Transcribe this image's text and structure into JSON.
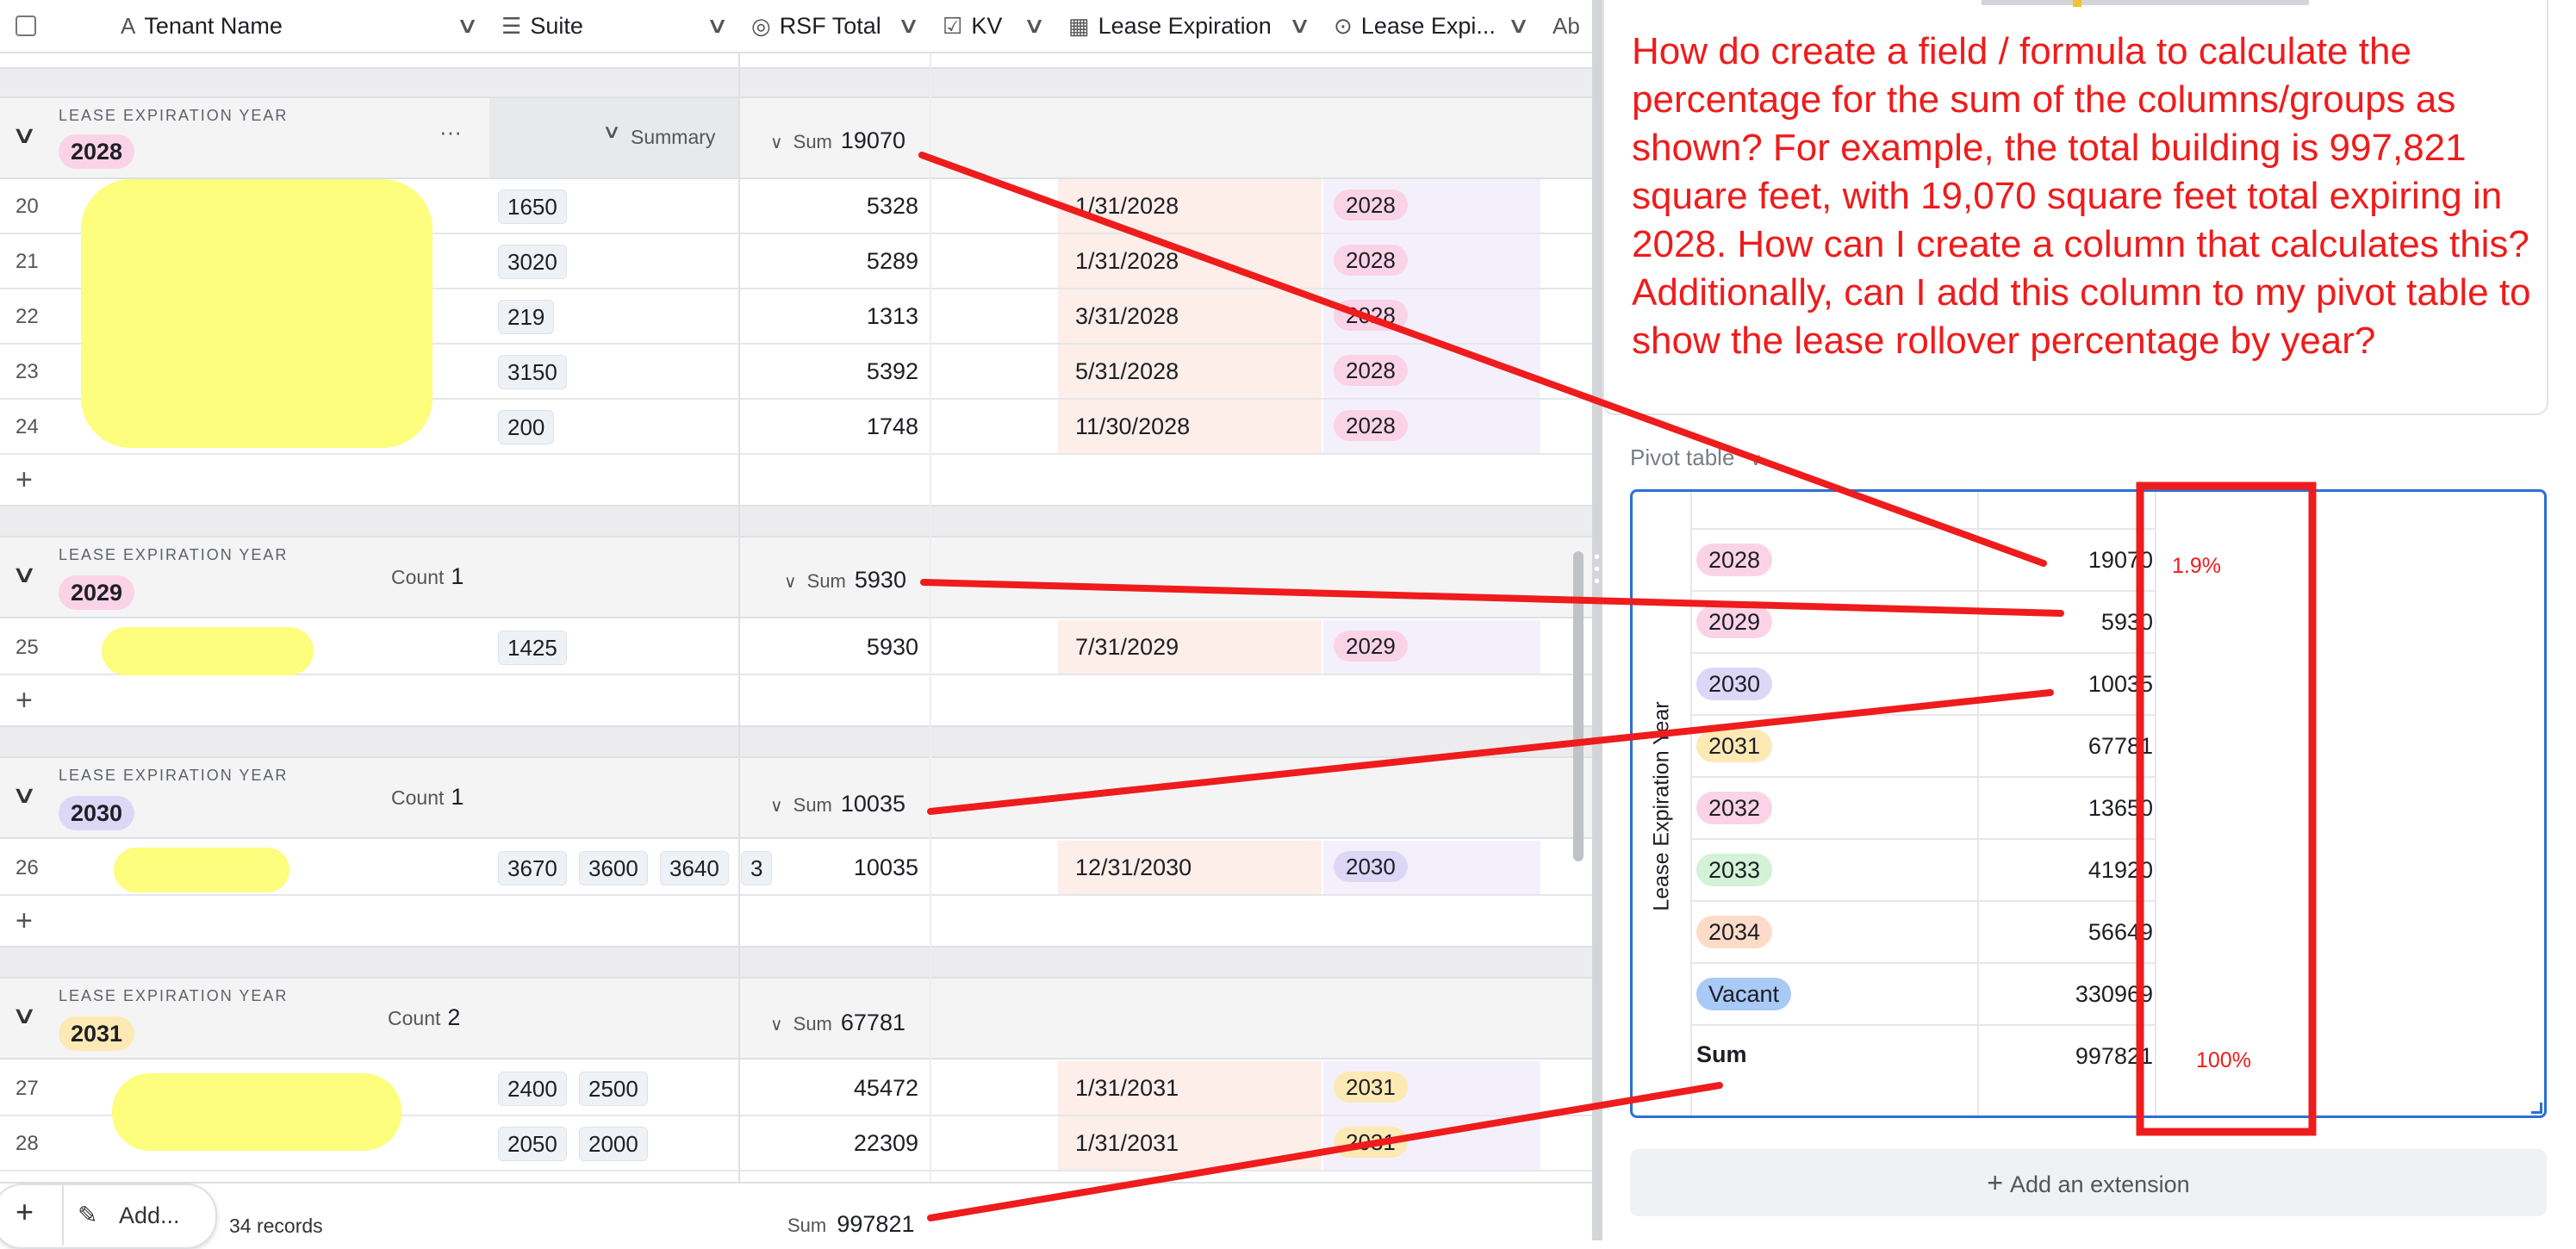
{
  "columns": {
    "tenant": "Tenant Name",
    "suite": "Suite",
    "rsf": "RSF Total",
    "kv": "KV",
    "lease_exp": "Lease Expiration",
    "lease_exp_year": "Lease Expi..."
  },
  "group_label": "LEASE EXPIRATION YEAR",
  "summary_label": "Summary",
  "count_label": "Count",
  "sum_label": "Sum",
  "groups": [
    {
      "year": "2028",
      "sum": "19070",
      "count": "",
      "color": "#fbd3e6"
    },
    {
      "year": "2029",
      "sum": "5930",
      "count": "1",
      "color": "#fbd3e6"
    },
    {
      "year": "2030",
      "sum": "10035",
      "count": "1",
      "color": "#ddd7f7"
    },
    {
      "year": "2031",
      "sum": "67781",
      "count": "2",
      "color": "#fde9b4"
    }
  ],
  "rows": [
    {
      "num": "20",
      "suites": [
        "1650"
      ],
      "rsf": "5328",
      "date": "1/31/2028",
      "year": "2028"
    },
    {
      "num": "21",
      "suites": [
        "3020"
      ],
      "rsf": "5289",
      "date": "1/31/2028",
      "year": "2028"
    },
    {
      "num": "22",
      "suites": [
        "219"
      ],
      "rsf": "1313",
      "date": "3/31/2028",
      "year": "2028"
    },
    {
      "num": "23",
      "suites": [
        "3150"
      ],
      "rsf": "5392",
      "date": "5/31/2028",
      "year": "2028"
    },
    {
      "num": "24",
      "suites": [
        "200"
      ],
      "rsf": "1748",
      "date": "11/30/2028",
      "year": "2028"
    },
    {
      "num": "25",
      "suites": [
        "1425"
      ],
      "rsf": "5930",
      "date": "7/31/2029",
      "year": "2029"
    },
    {
      "num": "26",
      "suites": [
        "3670",
        "3600",
        "3640",
        "3"
      ],
      "rsf": "10035",
      "date": "12/31/2030",
      "year": "2030"
    },
    {
      "num": "27",
      "suites": [
        "2400",
        "2500"
      ],
      "rsf": "45472",
      "date": "1/31/2031",
      "year": "2031"
    },
    {
      "num": "28",
      "suites": [
        "2050",
        "2000"
      ],
      "rsf": "22309",
      "date": "1/31/2031",
      "year": "2031"
    }
  ],
  "footer": {
    "add_label": "Add...",
    "records": "34 records",
    "sum_label": "Sum",
    "sum_value": "997821"
  },
  "question": "How do create a field / formula to calculate the percentage for the sum of the columns/groups as shown? For example, the total building is 997,821 square feet, with 19,070 square feet total expiring in 2028.  How can I create a column that calculates this? Additionally, can I add this column to my pivot table to show the lease rollover percentage by year?",
  "pivot": {
    "label": "Pivot table",
    "axis_label": "Lease Expiration Year",
    "rows": [
      {
        "year": "2028",
        "value": "19070",
        "pct": "1.9%",
        "color": "#fbd3e6"
      },
      {
        "year": "2029",
        "value": "5930",
        "pct": "",
        "color": "#fbd3e6"
      },
      {
        "year": "2030",
        "value": "10035",
        "pct": "",
        "color": "#ddd7f7"
      },
      {
        "year": "2031",
        "value": "67781",
        "pct": "",
        "color": "#fde9b4"
      },
      {
        "year": "2032",
        "value": "13650",
        "pct": "",
        "color": "#fbd3e6"
      },
      {
        "year": "2033",
        "value": "41920",
        "pct": "",
        "color": "#d3f2d6"
      },
      {
        "year": "2034",
        "value": "56649",
        "pct": "",
        "color": "#fcdcc8"
      },
      {
        "year": "Vacant",
        "value": "330969",
        "pct": "",
        "color": "#a9c9f7"
      }
    ],
    "sum_label": "Sum",
    "sum_value": "997821",
    "sum_pct": "100%"
  },
  "add_extension": "Add an extension",
  "colors": {
    "annotation": "#ee1c1c",
    "selection": "#2d6fd6"
  }
}
